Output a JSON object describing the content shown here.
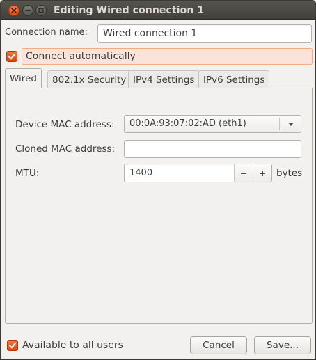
{
  "window": {
    "title": "Editing Wired connection 1",
    "controls": {
      "close": "close-icon",
      "minimize": "minimize-icon",
      "maximize": "maximize-icon"
    }
  },
  "connection": {
    "name_label": "Connection name:",
    "name_value": "Wired connection 1",
    "auto_connect_label": "Connect automatically",
    "auto_connect_checked": true
  },
  "tabs": [
    {
      "label": "Wired",
      "active": true
    },
    {
      "label": "802.1x Security",
      "active": false
    },
    {
      "label": "IPv4 Settings",
      "active": false
    },
    {
      "label": "IPv6 Settings",
      "active": false
    }
  ],
  "wired": {
    "device_mac_label": "Device MAC address:",
    "device_mac_value": "00:0A:93:07:02:AD (eth1)",
    "cloned_mac_label": "Cloned MAC address:",
    "cloned_mac_value": "",
    "mtu_label": "MTU:",
    "mtu_value": "1400",
    "mtu_unit": "bytes"
  },
  "footer": {
    "all_users_label": "Available to all users",
    "all_users_checked": true,
    "cancel_label": "Cancel",
    "save_label": "Save..."
  },
  "colors": {
    "accent": "#dd4814",
    "titlebar": "#4b4a45",
    "window_bg": "#f2f1f0",
    "highlight_bg": "#fbe3d9"
  }
}
